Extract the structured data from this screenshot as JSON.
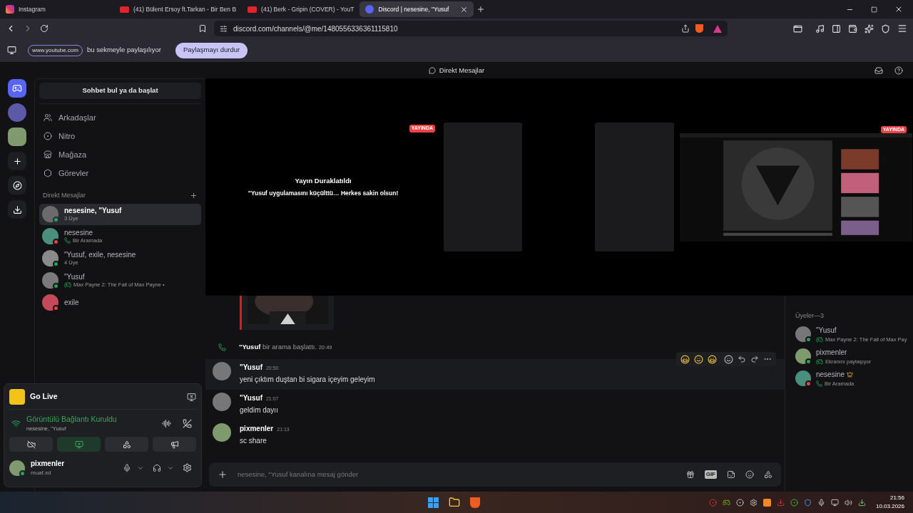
{
  "browser": {
    "tabs": [
      {
        "kind": "instagram",
        "title": "Instagram",
        "selected": false
      },
      {
        "kind": "youtube",
        "title": "(41) Bülent Ersoy ft.Tarkan - Bir Ben B",
        "selected": false
      },
      {
        "kind": "youtube",
        "title": "(41) Berk - Gripin (COVER) - YouT",
        "selected": false
      },
      {
        "kind": "discord",
        "title": "Discord | nesesine, \"Yusuf",
        "selected": true
      }
    ],
    "address": "discord.com/channels/@me/1480556336361115810",
    "share_bar": {
      "site": "www.youtube.com",
      "text": "bu sekmeyle paylaşılıyor",
      "button": "Paylaşmayı durdur"
    }
  },
  "discord": {
    "header": "Direkt Mesajlar",
    "search": "Sohbet bul ya da başlat",
    "nav": [
      {
        "kind": "friends",
        "label": "Arkadaşlar"
      },
      {
        "kind": "nitro",
        "label": "Nitro"
      },
      {
        "kind": "shop",
        "label": "Mağaza"
      },
      {
        "kind": "quests",
        "label": "Görevler"
      }
    ],
    "dm_heading": "Direkt Mesajlar",
    "dms": [
      {
        "name": "nesesine, \"Yusuf",
        "sub": "3 Üye",
        "kind": "members",
        "selected": true,
        "color": "#23a55a"
      },
      {
        "name": "nesesine",
        "sub": "Bir Aramada",
        "kind": "call",
        "selected": false,
        "color": "#f23f43"
      },
      {
        "name": "\"Yusuf, exile, nesesine",
        "sub": "4 Üye",
        "kind": "members",
        "selected": false,
        "color": "#23a55a"
      },
      {
        "name": "\"Yusuf",
        "sub": "Max Payne 2: The Fall of Max Payne •",
        "kind": "game",
        "selected": false,
        "color": "#23a55a"
      },
      {
        "name": "exile",
        "selected": false,
        "color": "#f23f43"
      }
    ],
    "stream": {
      "paused_badge": "YAYINDA",
      "paused_title": "Yayın Duraklatıldı",
      "paused_text": "\"Yusuf uygulamasını küçülttü… Herkes sakin olsun!",
      "live_badge": "YAYINDA"
    },
    "system_message": {
      "author": "\"Yusuf",
      "text": "bir arama başlattı.",
      "time": "20:49"
    },
    "messages": [
      {
        "author": "\"Yusuf",
        "time": "20:50",
        "text": "yeni çıktım duştan bi sigara içeyim geleyim",
        "hovered": true
      },
      {
        "author": "\"Yusuf",
        "time": "21:07",
        "text": "geldim dayıı",
        "hovered": false
      },
      {
        "author": "pixmenler",
        "time": "21:13",
        "text": "sc share",
        "hovered": false
      }
    ],
    "composer": {
      "placeholder": "nesesine, \"Yusuf kanalına mesaj gönder",
      "gif": "GIF"
    },
    "members_heading": "Üyeler—3",
    "members": [
      {
        "name": "\"Yusuf",
        "activity": "Max Payne 2: The Fall of Max Pay",
        "kind": "game",
        "owner": false,
        "color": "#23a55a"
      },
      {
        "name": "pixmenler",
        "activity": "Ekranını paylaşıyor",
        "kind": "game",
        "owner": false,
        "color": "#23a55a"
      },
      {
        "name": "nesesine",
        "activity": "Bir Aramada",
        "kind": "call",
        "owner": true,
        "color": "#f23f43"
      }
    ],
    "panel": {
      "go_live": "Go Live",
      "connection": "Görüntülü Bağlantı Kuruldu",
      "channel": "nesesine, \"Yusuf",
      "buttons": [
        {
          "kind": "camera",
          "on": false
        },
        {
          "kind": "screen",
          "on": true
        },
        {
          "kind": "activity",
          "on": false
        },
        {
          "kind": "soundboard",
          "on": false
        }
      ],
      "user": "pixmenler",
      "username": "muaf.xd"
    }
  },
  "taskbar": {
    "time": "21:56",
    "date": "10.03.2026"
  }
}
